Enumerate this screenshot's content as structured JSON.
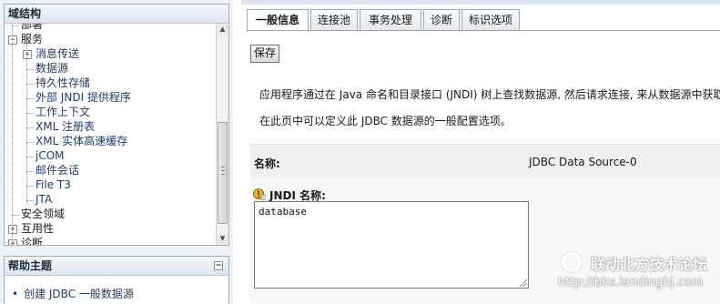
{
  "domain_panel": {
    "title": "域结构",
    "tree": [
      {
        "label": "部署",
        "level": 1,
        "toggle": "none"
      },
      {
        "label": "服务",
        "level": 1,
        "toggle": "-"
      },
      {
        "label": "消息传送",
        "level": 2,
        "toggle": "+"
      },
      {
        "label": "数据源",
        "level": 2,
        "toggle": "none"
      },
      {
        "label": "持久性存储",
        "level": 2,
        "toggle": "none"
      },
      {
        "label": "外部 JNDI 提供程序",
        "level": 2,
        "toggle": "none"
      },
      {
        "label": "工作上下文",
        "level": 2,
        "toggle": "none"
      },
      {
        "label": "XML 注册表",
        "level": 2,
        "toggle": "none"
      },
      {
        "label": "XML 实体高速缓存",
        "level": 2,
        "toggle": "none"
      },
      {
        "label": "jCOM",
        "level": 2,
        "toggle": "none"
      },
      {
        "label": "邮件会话",
        "level": 2,
        "toggle": "none"
      },
      {
        "label": "File T3",
        "level": 2,
        "toggle": "none"
      },
      {
        "label": "JTA",
        "level": 2,
        "toggle": "none"
      },
      {
        "label": "安全领域",
        "level": 1,
        "toggle": "none"
      },
      {
        "label": "互用性",
        "level": 1,
        "toggle": "+"
      },
      {
        "label": "诊断",
        "level": 1,
        "toggle": "+"
      }
    ]
  },
  "help_panel": {
    "title": "帮助主题",
    "collapse_glyph": "⊟",
    "links": [
      "创建 JDBC 一般数据源"
    ]
  },
  "tabs": [
    {
      "label": "一般信息",
      "active": true
    },
    {
      "label": "连接池",
      "active": false
    },
    {
      "label": "事务处理",
      "active": false
    },
    {
      "label": "诊断",
      "active": false
    },
    {
      "label": "标识选项",
      "active": false
    }
  ],
  "actions": {
    "save_label": "保存"
  },
  "description": {
    "line1": "应用程序通过在 Java 命名和目录接口 (JNDI) 树上查找数据源, 然后请求连接, 来从数据源中获取",
    "line2": "在此页中可以定义此 JDBC 数据源的一般配置选项。"
  },
  "form": {
    "name_label": "名称:",
    "name_value": "JDBC Data Source-0",
    "jndi_label": "JNDI 名称:",
    "jndi_value": "database"
  },
  "watermark": {
    "title": "联动北方技术论坛",
    "url": "http://bbs.landingbj.com"
  },
  "colors": {
    "link": "#1d3b6b",
    "panel_border": "#9aaec2",
    "row_bg": "#efefef"
  }
}
